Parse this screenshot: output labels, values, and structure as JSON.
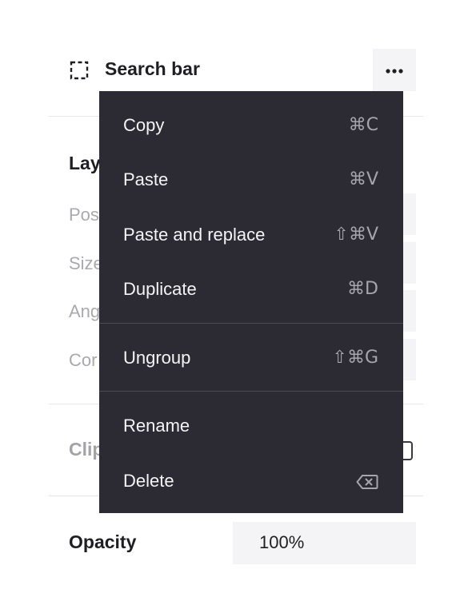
{
  "panel": {
    "title": "Search bar",
    "title_icon": "frame-select-icon",
    "more_icon": "more-horizontal-icon",
    "layout_label": "Lay",
    "properties": [
      {
        "label": "Pos"
      },
      {
        "label": "Size"
      },
      {
        "label": "Ang"
      },
      {
        "label": "Cor"
      }
    ],
    "clip_label": "Clip",
    "opacity_label": "Opacity",
    "opacity_value": "100%"
  },
  "menu": {
    "items": [
      {
        "label": "Copy",
        "shortcut": "⌘C"
      },
      {
        "label": "Paste",
        "shortcut": "⌘V"
      },
      {
        "label": "Paste and replace",
        "shortcut": "⇧⌘V"
      },
      {
        "label": "Duplicate",
        "shortcut": "⌘D"
      },
      {
        "label": "Ungroup",
        "shortcut": "⇧⌘G"
      },
      {
        "label": "Rename",
        "shortcut": ""
      },
      {
        "label": "Delete",
        "shortcut_icon": "backspace-icon"
      }
    ]
  },
  "colors": {
    "menu_background": "#2c2a33",
    "menu_text": "#f4f4f6",
    "shortcut_text": "#a6a5ad",
    "field_background": "#f4f4f6"
  }
}
